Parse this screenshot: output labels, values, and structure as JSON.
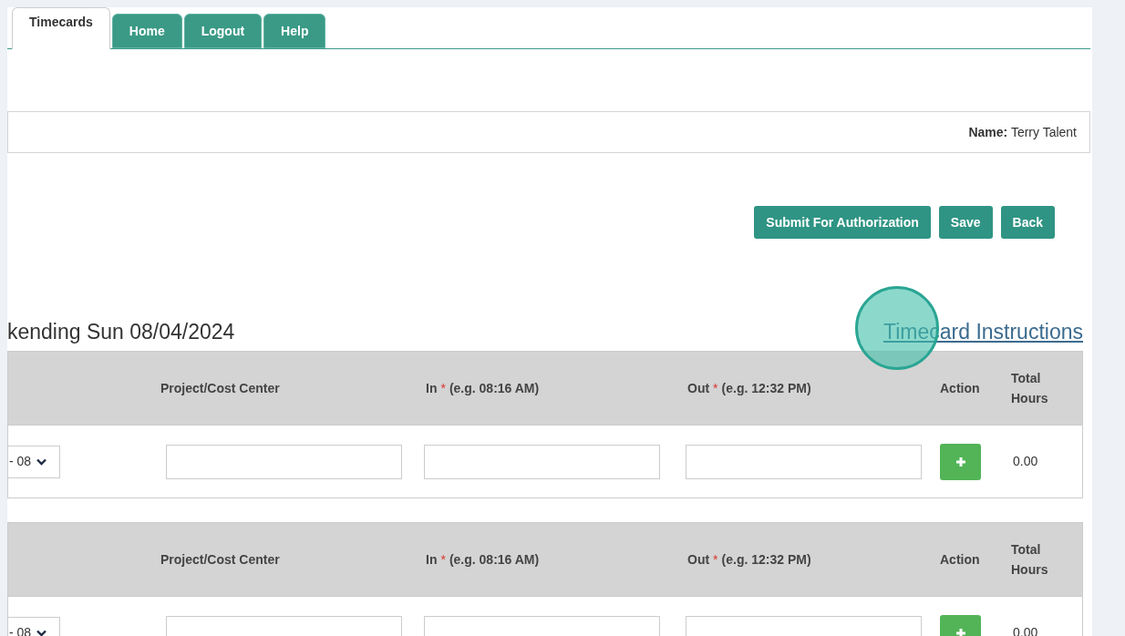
{
  "tabs": [
    {
      "label": "Timecards",
      "selected": true
    },
    {
      "label": "Home",
      "selected": false
    },
    {
      "label": "Logout",
      "selected": false
    },
    {
      "label": "Help",
      "selected": false
    }
  ],
  "employee": {
    "label": "Name:",
    "value": "Terry Talent"
  },
  "buttons": [
    "Submit For Authorization",
    "Save",
    "Back"
  ],
  "heading": "kending Sun 08/04/2024",
  "instructions_link": "Timecard Instructions",
  "tables": [
    {
      "columns": [
        {
          "label": "Project/Cost Center"
        },
        {
          "label": "In",
          "required_mark": "*",
          "hint": "(e.g. 08:16 AM)"
        },
        {
          "label": "Out",
          "required_mark": "*",
          "hint": "(e.g. 12:32 PM)"
        },
        {
          "label": "Action"
        },
        {
          "label": "Total Hours"
        }
      ],
      "rows": [
        {
          "day": "- 08",
          "total": "0.00"
        }
      ]
    },
    {
      "columns": [
        {
          "label": "Project/Cost Center"
        },
        {
          "label": "In",
          "required_mark": "*",
          "hint": "(e.g. 08:16 AM)"
        },
        {
          "label": "Out",
          "required_mark": "*",
          "hint": "(e.g. 12:32 PM)"
        },
        {
          "label": "Action"
        },
        {
          "label": "Total Hours"
        }
      ],
      "rows": [
        {
          "day": "- 08",
          "total": "0.00"
        }
      ]
    }
  ]
}
